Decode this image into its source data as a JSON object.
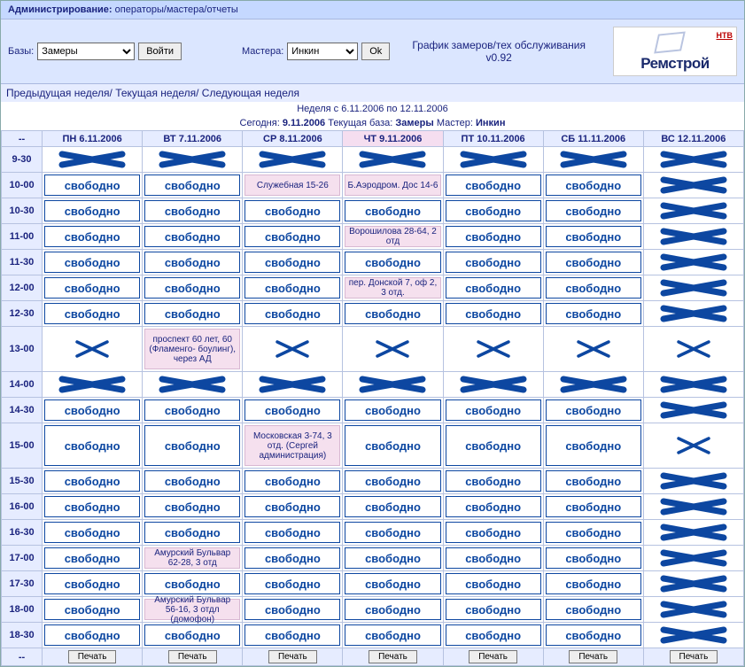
{
  "admin_label": "Администрирование:",
  "admin_links": "операторы/мастера/отчеты",
  "bases_label": "Базы:",
  "bases_value": "Замеры",
  "login_btn": "Войти",
  "masters_label": "Мастера:",
  "masters_value": "Инкин",
  "ok_btn": "Ok",
  "title_line1": "График замеров/тех обслуживания",
  "title_line2": "v0.92",
  "logo_main": "Ремстрой",
  "logo_small": "НТВ",
  "weeknav": "Предыдущая неделя/ Текущая неделя/ Следующая неделя",
  "range_text": "Неделя с 6.11.2006 по 12.11.2006",
  "today_prefix": "Сегодня: ",
  "today_date": "9.11.2006",
  "base_prefix": " Текущая база: ",
  "base_value": "Замеры",
  "master_prefix": " Мастер: ",
  "master_value": "Инкин",
  "corner": "--",
  "days": [
    {
      "short": "ПН",
      "date": "6.11.2006",
      "current": false
    },
    {
      "short": "ВТ",
      "date": "7.11.2006",
      "current": false
    },
    {
      "short": "СР",
      "date": "8.11.2006",
      "current": false
    },
    {
      "short": "ЧТ",
      "date": "9.11.2006",
      "current": true
    },
    {
      "short": "ПТ",
      "date": "10.11.2006",
      "current": false
    },
    {
      "short": "СБ",
      "date": "11.11.2006",
      "current": false
    },
    {
      "short": "ВС",
      "date": "12.11.2006",
      "current": false
    }
  ],
  "free_label": "свободно",
  "print_label": "Печать",
  "times": [
    "9-30",
    "10-00",
    "10-30",
    "11-00",
    "11-30",
    "12-00",
    "12-30",
    "13-00",
    "14-00",
    "14-30",
    "15-00",
    "15-30",
    "16-00",
    "16-30",
    "17-00",
    "17-30",
    "18-00",
    "18-30"
  ],
  "grid": [
    [
      "x",
      "x",
      "x",
      "x",
      "x",
      "x",
      "x"
    ],
    [
      "f",
      "f",
      {
        "t": "a",
        "v": "Служебная 15-26"
      },
      {
        "t": "a",
        "v": "Б.Аэродром. Дос 14-6"
      },
      "f",
      "f",
      "x"
    ],
    [
      "f",
      "f",
      "f",
      "f",
      "f",
      "f",
      "x"
    ],
    [
      "f",
      "f",
      "f",
      {
        "t": "a",
        "v": "Ворошилова 28-64, 2 отд"
      },
      "f",
      "f",
      "x"
    ],
    [
      "f",
      "f",
      "f",
      "f",
      "f",
      "f",
      "x"
    ],
    [
      "f",
      "f",
      "f",
      {
        "t": "a",
        "v": "пер. Донской 7, оф 2, 3 отд."
      },
      "f",
      "f",
      "x"
    ],
    [
      "f",
      "f",
      "f",
      "f",
      "f",
      "f",
      "x"
    ],
    [
      "x",
      {
        "t": "a",
        "v": "проспект 60 лет, 60 (Фламенго- боулинг), через АД",
        "tall": true
      },
      "x",
      "x",
      "x",
      "x",
      "x"
    ],
    [
      "x",
      "x",
      "x",
      "x",
      "x",
      "x",
      "x"
    ],
    [
      "f",
      "f",
      "f",
      "f",
      "f",
      "f",
      "x"
    ],
    [
      "f",
      "f",
      {
        "t": "a",
        "v": "Московская 3-74, 3 отд. (Сергей администрация)",
        "tall": true
      },
      "f",
      "f",
      "f",
      "x"
    ],
    [
      "f",
      "f",
      "f",
      "f",
      "f",
      "f",
      "x"
    ],
    [
      "f",
      "f",
      "f",
      "f",
      "f",
      "f",
      "x"
    ],
    [
      "f",
      "f",
      "f",
      "f",
      "f",
      "f",
      "x"
    ],
    [
      "f",
      {
        "t": "a",
        "v": "Амурский Бульвар 62-28, 3 отд"
      },
      "f",
      "f",
      "f",
      "f",
      "x"
    ],
    [
      "f",
      "f",
      "f",
      "f",
      "f",
      "f",
      "x"
    ],
    [
      "f",
      {
        "t": "a",
        "v": "Амурский Бульвар 56-16, 3 отдл (домофон)"
      },
      "f",
      "f",
      "f",
      "f",
      "x"
    ],
    [
      "f",
      "f",
      "f",
      "f",
      "f",
      "f",
      "x"
    ]
  ]
}
